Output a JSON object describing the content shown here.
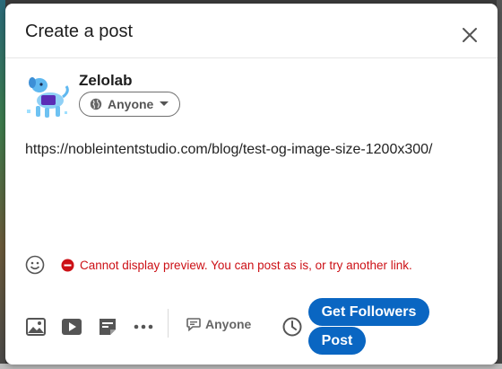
{
  "dialog": {
    "title": "Create a post"
  },
  "author": {
    "name": "Zelolab",
    "audience": "Anyone"
  },
  "post": {
    "text": "https://nobleintentstudio.com/blog/test-og-image-size-1200x300/"
  },
  "preview_error": {
    "message": "Cannot display preview. You can post as is, or try another link."
  },
  "toolbar": {
    "comment_visibility": "Anyone"
  },
  "actions": {
    "get_followers_label": "Get Followers",
    "post_label": "Post"
  },
  "colors": {
    "brand_blue": "#0a66c2",
    "error_red": "#cc1016"
  }
}
